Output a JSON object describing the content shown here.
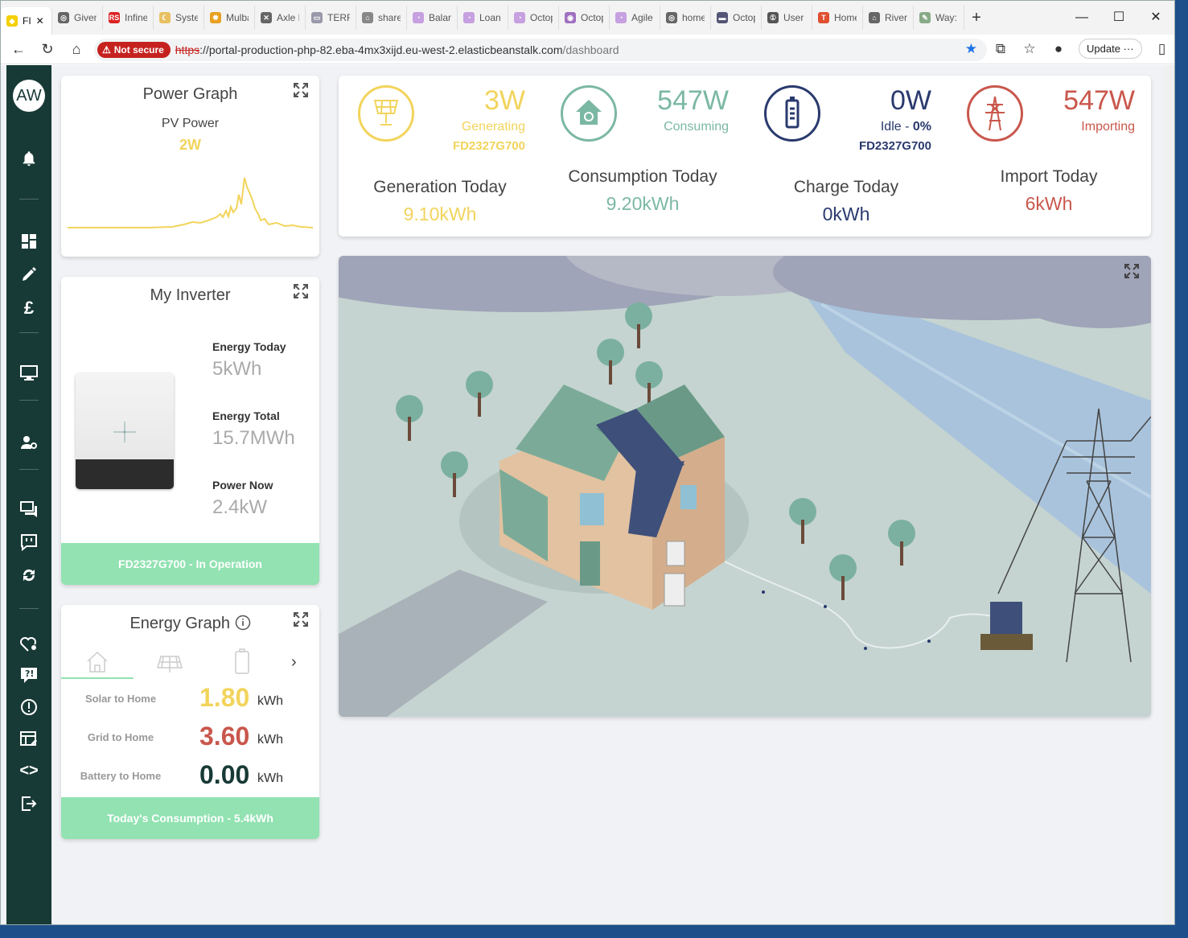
{
  "browser": {
    "tabs": [
      {
        "title": "FI",
        "color": "#f5d000",
        "glyph": "◆"
      },
      {
        "title": "Given",
        "color": "#666",
        "glyph": "◎"
      },
      {
        "title": "Infine",
        "color": "#d22",
        "glyph": "RS"
      },
      {
        "title": "Syster",
        "color": "#e8c060",
        "glyph": "☾"
      },
      {
        "title": "Mulba",
        "color": "#e8a020",
        "glyph": "✹"
      },
      {
        "title": "Axle E",
        "color": "#666",
        "glyph": "✕"
      },
      {
        "title": "TERR",
        "color": "#99a",
        "glyph": "▭"
      },
      {
        "title": "share",
        "color": "#888",
        "glyph": "⌂"
      },
      {
        "title": "Balan",
        "color": "#c6a0e0",
        "glyph": "◔"
      },
      {
        "title": "Loan",
        "color": "#c6a0e0",
        "glyph": "◔"
      },
      {
        "title": "Octop",
        "color": "#c6a0e0",
        "glyph": "◔"
      },
      {
        "title": "Octop",
        "color": "#a070c0",
        "glyph": "◉"
      },
      {
        "title": "Agile",
        "color": "#c6a0e0",
        "glyph": "◔"
      },
      {
        "title": "home",
        "color": "#666",
        "glyph": "◎"
      },
      {
        "title": "Octop",
        "color": "#557",
        "glyph": "▬"
      },
      {
        "title": "User",
        "color": "#555",
        "glyph": "①"
      },
      {
        "title": "Home",
        "color": "#e05030",
        "glyph": "T"
      },
      {
        "title": "Rivers",
        "color": "#666",
        "glyph": "⌂"
      },
      {
        "title": "Way:",
        "color": "#8a8",
        "glyph": "✎"
      }
    ],
    "not_secure": "Not secure",
    "url_scheme": "https",
    "url_host": "://portal-production-php-82.eba-4mx3xijd.eu-west-2.elasticbeanstalk.com",
    "url_path": "/dashboard",
    "update_label": "Update"
  },
  "sidebar": {
    "avatar": "AW"
  },
  "power_graph": {
    "title": "Power Graph",
    "subtitle": "PV Power",
    "value": "2W"
  },
  "inverter": {
    "title": "My Inverter",
    "energy_today_label": "Energy Today",
    "energy_today_value": "5kWh",
    "energy_total_label": "Energy Total",
    "energy_total_value": "15.7MWh",
    "power_now_label": "Power Now",
    "power_now_value": "2.4kW",
    "status": "FD2327G700 - In Operation"
  },
  "energy_graph": {
    "title": "Energy Graph",
    "rows": [
      {
        "label": "Solar to Home",
        "value": "1.80",
        "unit": "kWh",
        "color": "#f2d45c"
      },
      {
        "label": "Grid to Home",
        "value": "3.60",
        "unit": "kWh",
        "color": "#c9574c"
      },
      {
        "label": "Battery to Home",
        "value": "0.00",
        "unit": "kWh",
        "color": "#183a36"
      }
    ],
    "footer": "Today's Consumption - 5.4kWh"
  },
  "stats": {
    "solar": {
      "value": "3W",
      "status": "Generating",
      "serial": "FD2327G700",
      "color": "#f2d45c"
    },
    "home": {
      "value": "547W",
      "status": "Consuming",
      "color": "#7bb8a4"
    },
    "battery": {
      "value": "0W",
      "status_prefix": "Idle - ",
      "status_pct": "0%",
      "serial": "FD2327G700",
      "color": "#2a3a6e"
    },
    "grid": {
      "value": "547W",
      "status": "Importing",
      "color": "#c9574c"
    },
    "generation_today_label": "Generation Today",
    "generation_today_value": "9.10kWh",
    "consumption_today_label": "Consumption Today",
    "consumption_today_value": "9.20kWh",
    "charge_today_label": "Charge Today",
    "charge_today_value": "0kWh",
    "import_today_label": "Import Today",
    "import_today_value": "6kWh"
  }
}
